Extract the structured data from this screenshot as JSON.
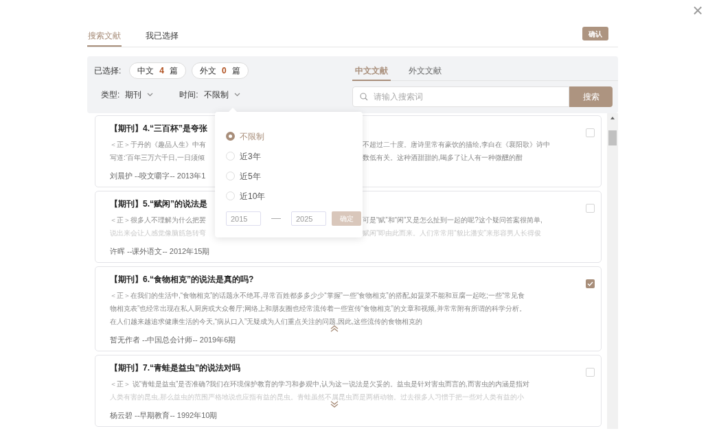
{
  "close_label": "×",
  "tabs": [
    {
      "label": "搜索文献",
      "selected": true
    },
    {
      "label": "我已选择",
      "selected": false
    }
  ],
  "confirm_button": "确认",
  "selected_summary": {
    "label": "已选择:",
    "pills": [
      {
        "prefix": "中文",
        "count": "4",
        "suffix": "篇"
      },
      {
        "prefix": "外文",
        "count": "0",
        "suffix": "篇"
      }
    ]
  },
  "source_tabs": [
    {
      "label": "中文文献",
      "selected": true
    },
    {
      "label": "外文文献",
      "selected": false
    }
  ],
  "filters": [
    {
      "label": "类型:",
      "value": "期刊"
    },
    {
      "label": "时间:",
      "value": "不限制"
    }
  ],
  "search": {
    "placeholder": "请输入搜索词",
    "button": "搜索"
  },
  "time_popup": {
    "options": [
      {
        "label": "不限制",
        "selected": true
      },
      {
        "label": "近3年",
        "selected": false
      },
      {
        "label": "近5年",
        "selected": false
      },
      {
        "label": "近10年",
        "selected": false
      }
    ],
    "from": "2015",
    "to": "2025",
    "confirm": "确定"
  },
  "results": [
    {
      "title": "【期刊】4.“三百杯”是夸张",
      "lines": [
        [
          "＜正＞于丹的《趣品人生》中有",
          "不超过二十度。唐诗里常有豪饮的描绘,李白在《襄阳歌》诗中"
        ],
        [
          "写道:‘百年三万六千日,一日须倾",
          "数低有关。这种酒甜甜的,喝多了让人有一种微醺的酣"
        ]
      ],
      "meta": "刘晨护 --咬文嚼字-- 2013年1",
      "checked": false
    },
    {
      "title": "【期刊】5.“赋闲”的说法是",
      "lines": [
        [
          "＜正＞很多人不理解为什么把罢",
          "可是“赋”和“闲”又是怎么扯到一起的呢?这个疑问答案很简单,"
        ],
        [
          "说出来会让人感觉像脑筋急转弯",
          "赋闲”即由此而来。人们常常用“貌比潘安”来形容男人长得俊"
        ]
      ],
      "fade_last_line": true,
      "meta": "许晖 --课外语文-- 2012年15期",
      "checked": false
    },
    {
      "title": "【期刊】6.“食物相克”的说法是真的吗?",
      "lines": [
        [
          "＜正＞在我们的生活中,“食物相克”的话题永不绝耳,寻常百姓都多多少少“掌握”一些“食物相克”的搭配,如菠菜不能和豆腐一起吃;一些“常见食"
        ],
        [
          "物相克表”也经常出现在私人厨房或大众餐厅;网络上和朋友圈也经常流传着一些宣传“食物相克”的文章和视频,并常常附有所谓的科学分析。"
        ],
        [
          "在人们越来越追求健康生活的今天,“病从口入”无疑成为人们重点关注的问题,因此,这些流传的食物相克的"
        ]
      ],
      "expanded": true,
      "meta": "暂无作者 --中国总会计师-- 2019年6期",
      "checked": true
    },
    {
      "title": "【期刊】7.“青蛙是益虫”的说法对吗",
      "lines": [
        [
          "＜正＞ 说“青蛙是益虫”是否准确?我们在环境保护教育的学习和参观中,认为这一说法是欠妥的。益虫是针对害虫而言的,而害虫的内涵是指对"
        ],
        [
          "人类有害的昆虫,那么益虫的范围严格地说也应指有益的昆虫。青蛙虽然不属昆虫而是两栖动物。过去很多人习惯于把一些对人类有益的小"
        ]
      ],
      "expanded": false,
      "meta": "杨云碧 --早期教育-- 1992年10期",
      "checked": false
    }
  ]
}
